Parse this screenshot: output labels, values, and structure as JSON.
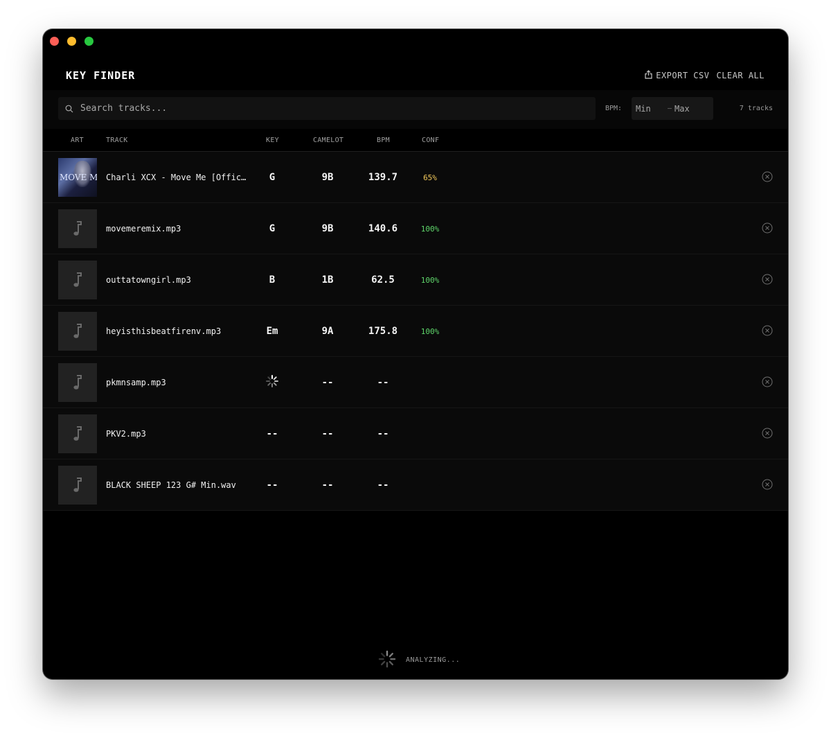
{
  "app": {
    "title": "KEY FINDER"
  },
  "header": {
    "export_label": "EXPORT CSV",
    "clear_label": "CLEAR ALL"
  },
  "search": {
    "placeholder": "Search tracks..."
  },
  "bpm_filter": {
    "label": "BPM:",
    "min_placeholder": "Min",
    "max_placeholder": "Max"
  },
  "track_count": "7 tracks",
  "columns": {
    "art": "ART",
    "track": "TRACK",
    "key": "KEY",
    "camelot": "CAMELOT",
    "bpm": "BPM",
    "conf": "CONF"
  },
  "cover_text": "MOVE M",
  "colors": {
    "conf_high": "#5fd66b",
    "conf_medium": "#f0c75a",
    "background": "#000000"
  },
  "tracks": [
    {
      "name": "Charli XCX - Move Me [Offic…",
      "key": "G",
      "camelot": "9B",
      "bpm": "139.7",
      "conf": "65%",
      "conf_level": "medium",
      "art": "cover",
      "status": "done"
    },
    {
      "name": "movemeremix.mp3",
      "key": "G",
      "camelot": "9B",
      "bpm": "140.6",
      "conf": "100%",
      "conf_level": "high",
      "art": "music-note-icon",
      "status": "done"
    },
    {
      "name": "outtatowngirl.mp3",
      "key": "B",
      "camelot": "1B",
      "bpm": "62.5",
      "conf": "100%",
      "conf_level": "high",
      "art": "music-note-icon",
      "status": "done"
    },
    {
      "name": "heyisthisbeatfirenv.mp3",
      "key": "Em",
      "camelot": "9A",
      "bpm": "175.8",
      "conf": "100%",
      "conf_level": "high",
      "art": "music-note-icon",
      "status": "done"
    },
    {
      "name": "pkmnsamp.mp3",
      "key": "",
      "camelot": "--",
      "bpm": "--",
      "conf": "",
      "art": "music-note-icon",
      "status": "analyzing"
    },
    {
      "name": "PKV2.mp3",
      "key": "--",
      "camelot": "--",
      "bpm": "--",
      "conf": "",
      "art": "music-note-icon",
      "status": "pending"
    },
    {
      "name": "BLACK SHEEP 123 G# Min.wav",
      "key": "--",
      "camelot": "--",
      "bpm": "--",
      "conf": "",
      "art": "music-note-icon",
      "status": "pending"
    }
  ],
  "status": {
    "text": "ANALYZING..."
  }
}
